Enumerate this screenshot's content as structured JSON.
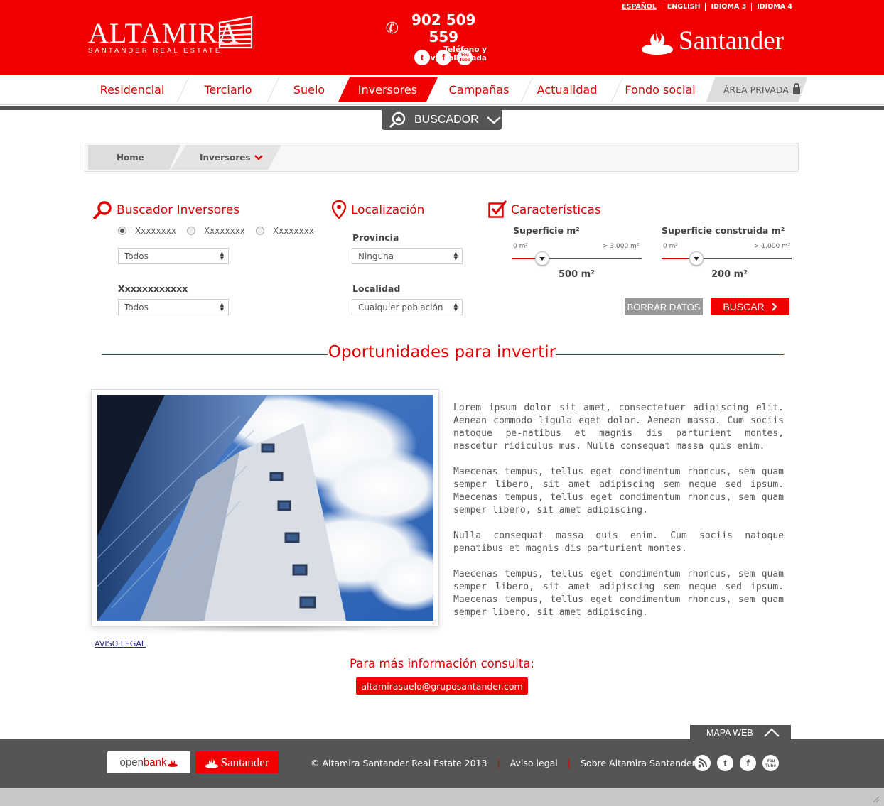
{
  "header": {
    "logo_name": "ALTAMIRA",
    "logo_subtitle": "SANTANDER REAL ESTATE",
    "phone": "902 509 559",
    "phone_sub": "Teléfono y videollamada",
    "languages": [
      "ESPAÑOL",
      "ENGLISH",
      "IDIOMA 3",
      "IDIOMA 4"
    ],
    "bank_name": "Santander",
    "socials": [
      "twitter-icon",
      "facebook-icon",
      "youtube-icon"
    ],
    "youtube_label": "You Tube"
  },
  "nav": {
    "items": [
      "Residencial",
      "Terciario",
      "Suelo",
      "Inversores",
      "Campañas",
      "Actualidad",
      "Fondo social"
    ],
    "active": "Inversores",
    "private_area": "ÁREA PRIVADA"
  },
  "buscador": {
    "label": "BUSCADOR"
  },
  "breadcrumb": {
    "home": "Home",
    "current": "Inversores"
  },
  "search": {
    "section1": {
      "title": "Buscador Inversores",
      "radios": [
        "Xxxxxxxx",
        "Xxxxxxxx",
        "Xxxxxxxx"
      ],
      "select1": "Todos",
      "label2": "Xxxxxxxxxxxx",
      "select2": "Todos"
    },
    "section2": {
      "title": "Localización",
      "provincia_label": "Provincia",
      "provincia_value": "Ninguna",
      "localidad_label": "Localidad",
      "localidad_value": "Cualquier población"
    },
    "section3": {
      "title": "Características",
      "slider1": {
        "label": "Superficie m²",
        "min_label": "0 m²",
        "max_label": "> 3.000 m²",
        "value": "500 m²",
        "fraction": 0.17
      },
      "slider2": {
        "label": "Superficie construida m²",
        "min_label": "0 m²",
        "max_label": "> 1.000 m²",
        "value": "200 m²",
        "fraction": 0.2
      },
      "clear_button": "BORRAR DATOS",
      "search_button": "BUSCAR"
    }
  },
  "opportunities": {
    "title": "Oportunidades para invertir",
    "paragraphs": [
      "Lorem ipsum dolor sit amet, consectetuer adipiscing elit. Aenean commodo ligula eget dolor. Aenean massa. Cum sociis natoque pe-natibus et magnis dis parturient montes, nascetur ridiculus mus. Nulla consequat massa quis enim.",
      "Maecenas tempus, tellus eget condimentum rhoncus, sem quam semper libero, sit amet adipiscing sem neque sed ipsum.  Maecenas tempus, tellus eget condimentum rhoncus, sem quam semper libero, sit amet adipiscing.",
      "Nulla consequat massa quis enim. Cum sociis natoque penatibus et magnis dis parturient montes.",
      "Maecenas tempus, tellus eget condimentum rhoncus, sem quam semper libero, sit amet adipiscing sem neque sed ipsum.  Maecenas tempus, tellus eget condimentum rhoncus, sem quam semper libero, sit amet adipiscing."
    ]
  },
  "aviso_legal": "AVISO LEGAL",
  "contact": {
    "heading": "Para más información consulta:",
    "email": "altamirasuelo@gruposantander.com"
  },
  "footer": {
    "map_tab": "MAPA WEB",
    "openbank_a": "open",
    "openbank_b": "bank",
    "santander": "Santander",
    "copyright": "© Altamira Santander Real Estate 2013",
    "links": [
      "Aviso legal",
      "Sobre Altamira Santander"
    ],
    "socials": [
      "rss-icon",
      "twitter-icon",
      "facebook-icon",
      "youtube-icon"
    ],
    "youtube_label": "You Tube"
  },
  "colors": {
    "brand_red": "#f20000",
    "dark_gray": "#555555"
  }
}
